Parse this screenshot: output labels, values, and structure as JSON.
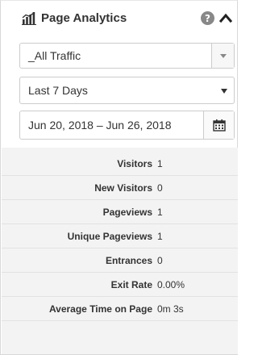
{
  "header": {
    "title": "Page Analytics",
    "icons": [
      "bar-chart-icon",
      "help-icon",
      "collapse-icon"
    ],
    "help_glyph": "?"
  },
  "segment_select": {
    "value": "_All Traffic"
  },
  "period_select": {
    "value": "Last 7 Days"
  },
  "date_range": {
    "value": "Jun 20, 2018 – Jun 26, 2018",
    "icon": "calendar-icon"
  },
  "stats": [
    {
      "label": "Visitors",
      "value": "1"
    },
    {
      "label": "New Visitors",
      "value": "0"
    },
    {
      "label": "Pageviews",
      "value": "1"
    },
    {
      "label": "Unique Pageviews",
      "value": "1"
    },
    {
      "label": "Entrances",
      "value": "0"
    },
    {
      "label": "Exit Rate",
      "value": "0.00%"
    },
    {
      "label": "Average Time on Page",
      "value": "0m 3s"
    }
  ],
  "colors": {
    "stats_bg": "#f3f3f3",
    "border": "#cccccc",
    "text": "#333333",
    "help_bg": "#888888"
  }
}
